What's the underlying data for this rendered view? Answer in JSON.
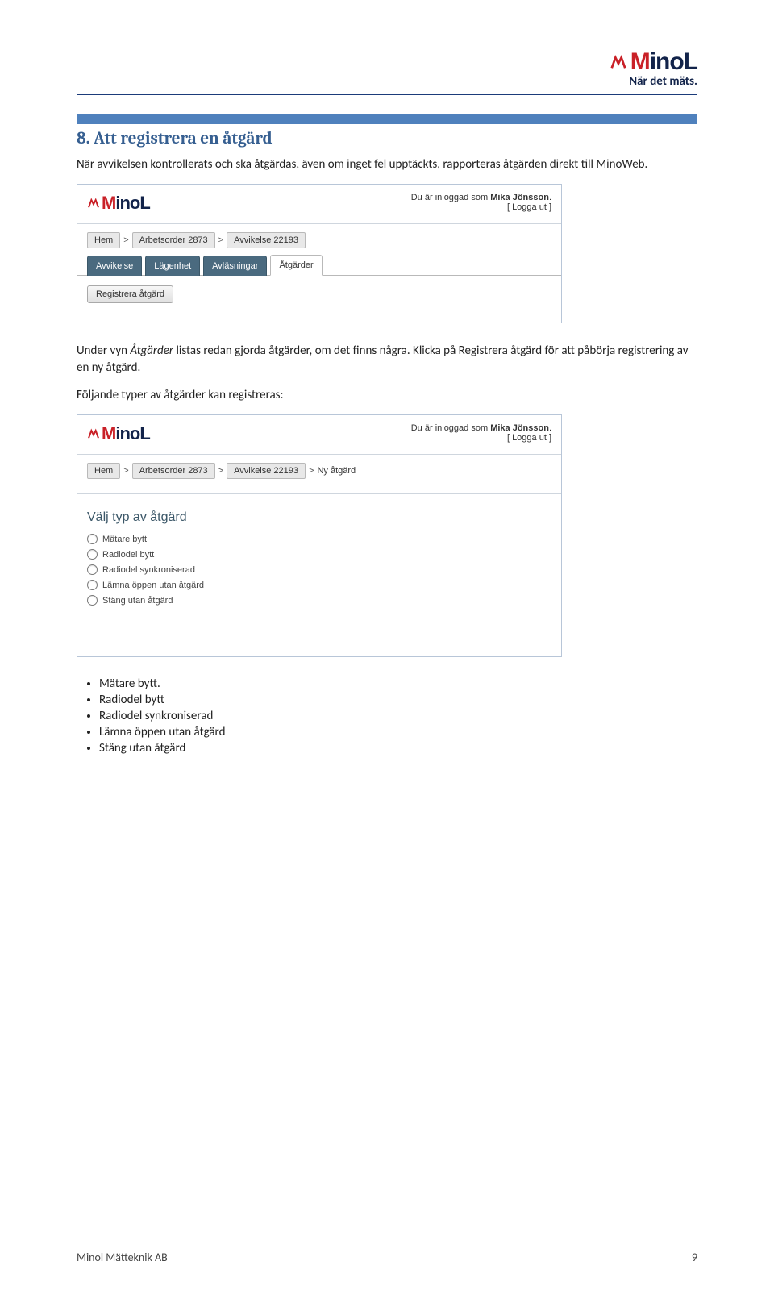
{
  "header": {
    "brand_red": "M",
    "brand_rest": "inoL",
    "tagline": "När det mäts."
  },
  "section": {
    "title": "8. Att registrera en åtgärd",
    "para1": "När avvikelsen kontrollerats och ska åtgärdas, även om inget fel upptäckts, rapporteras åtgärden direkt till MinoWeb.",
    "para2_a": "Under vyn ",
    "para2_italic": "Åtgärder",
    "para2_b": " listas redan gjorda åtgärder, om det finns några. Klicka på Registrera åtgärd för att påbörja registrering av en ny åtgärd.",
    "para3": "Följande typer av åtgärder kan registreras:"
  },
  "shot1": {
    "login_prefix": "Du är inloggad som ",
    "login_name": "Mika Jönsson",
    "login_suffix": ".",
    "logout": "[ Logga ut ]",
    "crumbs": [
      "Hem",
      "Arbetsorder 2873",
      "Avvikelse 22193"
    ],
    "tabs": [
      {
        "label": "Avvikelse",
        "active": false
      },
      {
        "label": "Lägenhet",
        "active": false
      },
      {
        "label": "Avläsningar",
        "active": false
      },
      {
        "label": "Åtgärder",
        "active": true
      }
    ],
    "button": "Registrera åtgärd"
  },
  "shot2": {
    "login_prefix": "Du är inloggad som ",
    "login_name": "Mika Jönsson",
    "login_suffix": ".",
    "logout": "[ Logga ut ]",
    "crumbs": [
      "Hem",
      "Arbetsorder 2873",
      "Avvikelse 22193",
      "Ny åtgärd"
    ],
    "panel_title": "Välj typ av åtgärd",
    "options": [
      "Mätare bytt",
      "Radiodel bytt",
      "Radiodel synkroniserad",
      "Lämna öppen utan åtgärd",
      "Stäng utan åtgärd"
    ]
  },
  "list": {
    "items": [
      "Mätare bytt.",
      "Radiodel bytt",
      "Radiodel synkroniserad",
      "Lämna öppen utan åtgärd",
      "Stäng utan åtgärd"
    ]
  },
  "footer": {
    "left": "Minol Mätteknik AB",
    "right": "9"
  }
}
